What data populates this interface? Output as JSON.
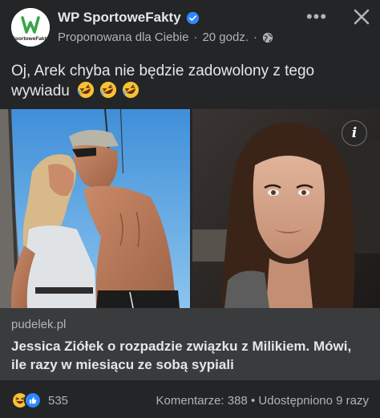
{
  "header": {
    "page_name": "WP SportoweFakty",
    "logo_text": "SportoweFakty",
    "logo_mark": "WP",
    "suggested": "Proponowana dla Ciebie",
    "separator": "·",
    "time": "20 godz.",
    "separator2": "·",
    "more_icon": "more-horizontal-icon",
    "close_icon": "close-icon",
    "verified_color": "#2d88ff",
    "brand_color": "#3aa54a"
  },
  "post": {
    "text": "Oj, Arek chyba nie będzie zadowolony z tego wywiadu",
    "emojis": [
      "rolling-on-floor-laughing",
      "rolling-on-floor-laughing",
      "rolling-on-floor-laughing"
    ]
  },
  "media": {
    "info_label": "i"
  },
  "link": {
    "domain": "pudelek.pl",
    "title": "Jessica Ziółek o rozpadzie związku z Milikiem. Mówi, ile razy w miesiącu ze sobą sypiali"
  },
  "footer": {
    "reaction_count": "535",
    "comments": "Komentarze: 388",
    "dot": "•",
    "shares": "Udostępniono 9 razy",
    "reactions": [
      "haha",
      "like"
    ]
  }
}
